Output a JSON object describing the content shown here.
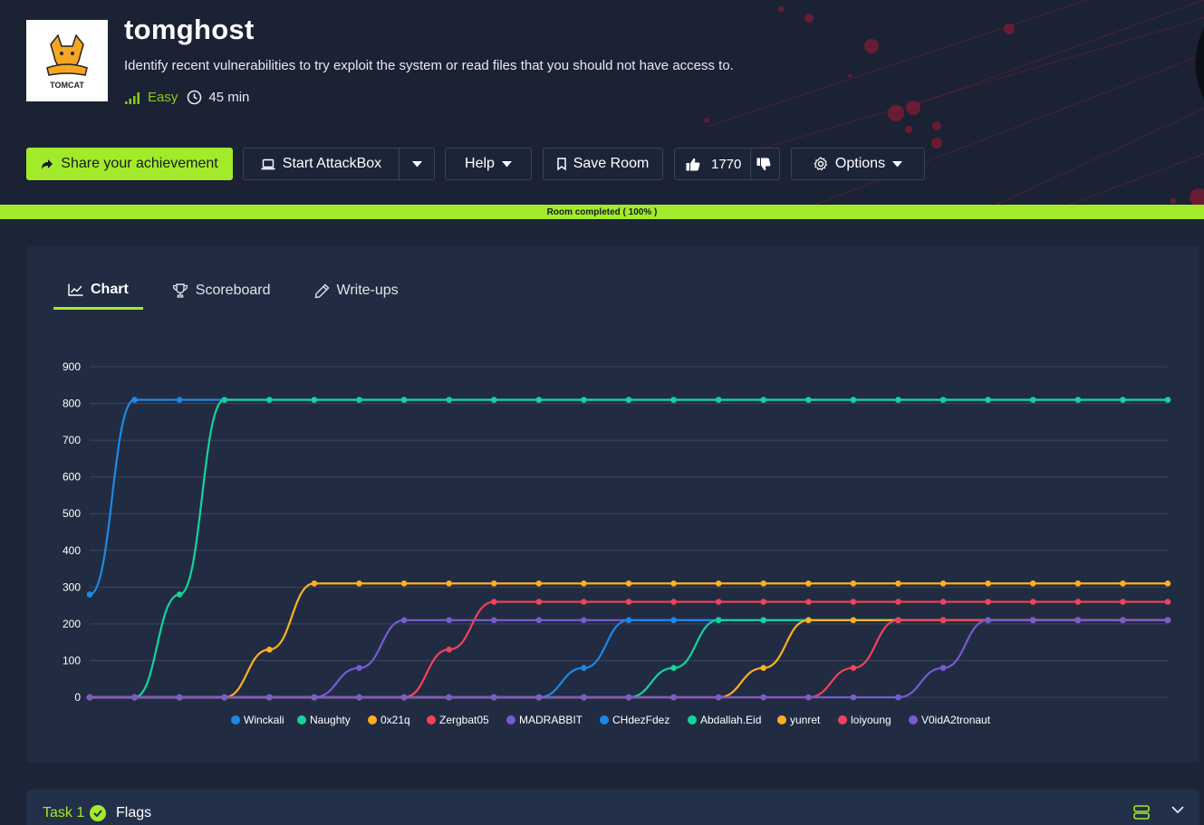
{
  "room": {
    "title": "tomghost",
    "description": "Identify recent vulnerabilities to try exploit the system or read files that you should not have access to.",
    "difficulty": "Easy",
    "time": "45 min",
    "logo_text": "TOMCAT"
  },
  "actions": {
    "share": "Share your achievement",
    "attackbox": "Start AttackBox",
    "help": "Help",
    "save": "Save Room",
    "likes": "1770",
    "options": "Options"
  },
  "progress": {
    "label": "Room completed ( 100% )",
    "value": 1.0
  },
  "tabs": [
    {
      "label": "Chart",
      "icon": "chart-line-icon",
      "active": true
    },
    {
      "label": "Scoreboard",
      "icon": "trophy-icon",
      "active": false
    },
    {
      "label": "Write-ups",
      "icon": "pen-icon",
      "active": false
    }
  ],
  "task": {
    "label": "Task 1",
    "title": "Flags"
  },
  "colors": {
    "accent": "#a3ea2a",
    "blue": "#1e88e5",
    "green": "#14d49a",
    "orange": "#ffb020",
    "red": "#f2425b",
    "purple": "#7a5bd1"
  },
  "chart_data": {
    "type": "line",
    "title": "",
    "xlabel": "",
    "ylabel": "",
    "ylim": [
      0,
      900
    ],
    "yticks": [
      0,
      100,
      200,
      300,
      400,
      500,
      600,
      700,
      800,
      900
    ],
    "x": [
      1,
      2,
      3,
      4,
      5,
      6,
      7,
      8,
      9,
      10,
      11,
      12,
      13,
      14,
      15,
      16,
      17,
      18,
      19,
      20,
      21,
      22,
      23,
      24,
      25
    ],
    "grid": true,
    "legend_position": "bottom",
    "series": [
      {
        "name": "Winckali",
        "color": "#1e88e5",
        "values": [
          280,
          810,
          810,
          810,
          810,
          810,
          810,
          810,
          810,
          810,
          810,
          810,
          810,
          810,
          810,
          810,
          810,
          810,
          810,
          810,
          810,
          810,
          810,
          810,
          810
        ]
      },
      {
        "name": "Naughty",
        "color": "#14d49a",
        "values": [
          0,
          0,
          280,
          810,
          810,
          810,
          810,
          810,
          810,
          810,
          810,
          810,
          810,
          810,
          810,
          810,
          810,
          810,
          810,
          810,
          810,
          810,
          810,
          810,
          810
        ]
      },
      {
        "name": "0x21q",
        "color": "#ffb020",
        "values": [
          0,
          0,
          0,
          0,
          130,
          310,
          310,
          310,
          310,
          310,
          310,
          310,
          310,
          310,
          310,
          310,
          310,
          310,
          310,
          310,
          310,
          310,
          310,
          310,
          310
        ]
      },
      {
        "name": "Zergbat05",
        "color": "#f2425b",
        "values": [
          0,
          0,
          0,
          0,
          0,
          0,
          0,
          0,
          130,
          260,
          260,
          260,
          260,
          260,
          260,
          260,
          260,
          260,
          260,
          260,
          260,
          260,
          260,
          260,
          260
        ]
      },
      {
        "name": "MADRABBIT",
        "color": "#7a5bd1",
        "values": [
          0,
          0,
          0,
          0,
          0,
          0,
          80,
          210,
          210,
          210,
          210,
          210,
          210,
          210,
          210,
          210,
          210,
          210,
          210,
          210,
          210,
          210,
          210,
          210,
          210
        ]
      },
      {
        "name": "CHdezFdez",
        "color": "#1e88e5",
        "values": [
          0,
          0,
          0,
          0,
          0,
          0,
          0,
          0,
          0,
          0,
          0,
          80,
          210,
          210,
          210,
          210,
          210,
          210,
          210,
          210,
          210,
          210,
          210,
          210,
          210
        ]
      },
      {
        "name": "Abdallah.Eid",
        "color": "#14d49a",
        "values": [
          0,
          0,
          0,
          0,
          0,
          0,
          0,
          0,
          0,
          0,
          0,
          0,
          0,
          80,
          210,
          210,
          210,
          210,
          210,
          210,
          210,
          210,
          210,
          210,
          210
        ]
      },
      {
        "name": "yunret",
        "color": "#ffb020",
        "values": [
          0,
          0,
          0,
          0,
          0,
          0,
          0,
          0,
          0,
          0,
          0,
          0,
          0,
          0,
          0,
          80,
          210,
          210,
          210,
          210,
          210,
          210,
          210,
          210,
          210
        ]
      },
      {
        "name": "loiyoung",
        "color": "#f2425b",
        "values": [
          0,
          0,
          0,
          0,
          0,
          0,
          0,
          0,
          0,
          0,
          0,
          0,
          0,
          0,
          0,
          0,
          0,
          80,
          210,
          210,
          210,
          210,
          210,
          210,
          210
        ]
      },
      {
        "name": "V0idA2tronaut",
        "color": "#7a5bd1",
        "values": [
          0,
          0,
          0,
          0,
          0,
          0,
          0,
          0,
          0,
          0,
          0,
          0,
          0,
          0,
          0,
          0,
          0,
          0,
          0,
          80,
          210,
          210,
          210,
          210,
          210
        ]
      }
    ]
  }
}
